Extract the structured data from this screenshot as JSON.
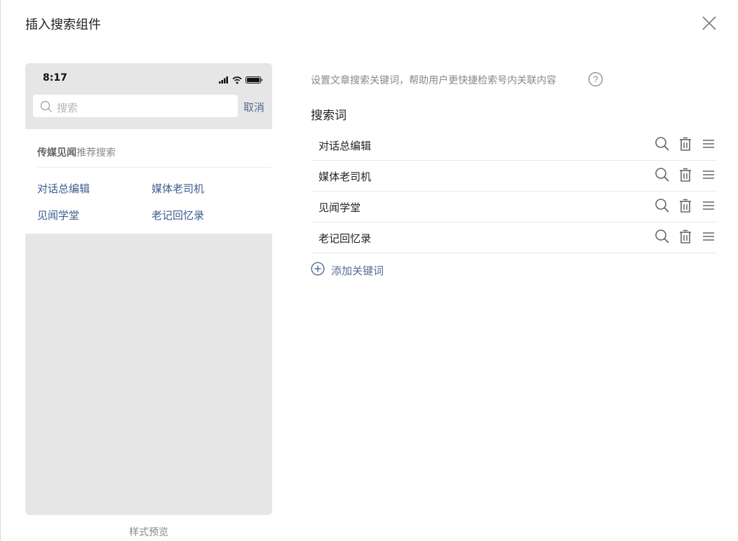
{
  "dialog": {
    "title": "插入搜索组件",
    "close_icon": "close-icon"
  },
  "preview": {
    "status_time": "8:17",
    "status_icons": [
      "signal-icon",
      "wifi-icon",
      "battery-icon"
    ],
    "search_placeholder": "搜索",
    "cancel_label": "取消",
    "rec_title_bold": "传媒见闻",
    "rec_title_rest": "推荐搜索",
    "rec_words": [
      "对话总编辑",
      "媒体老司机",
      "见闻学堂",
      "老记回忆录"
    ],
    "caption": "样式预览"
  },
  "settings": {
    "hint": "设置文章搜索关键词，帮助用户更快捷检索号内关联内容",
    "section_label": "搜索词",
    "keywords": [
      {
        "text": "对话总编辑"
      },
      {
        "text": "媒体老司机"
      },
      {
        "text": "见闻学堂"
      },
      {
        "text": "老记回忆录"
      }
    ],
    "row_actions": [
      "search-icon",
      "trash-icon",
      "drag-handle-icon"
    ],
    "add_label": "添加关键词"
  },
  "colors": {
    "link": "#576b95",
    "preview_bg": "#e6e6e6",
    "divider": "#e8e8e8"
  }
}
